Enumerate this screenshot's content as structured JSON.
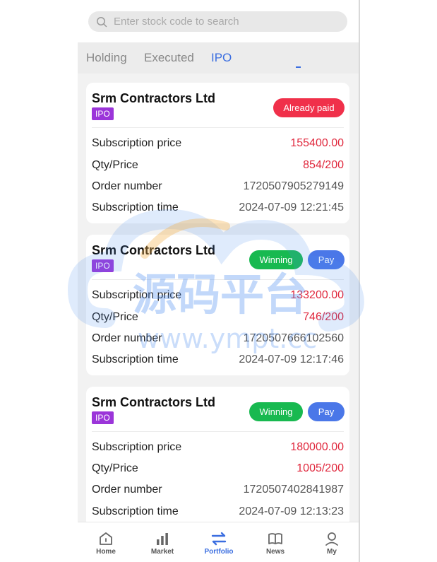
{
  "search": {
    "placeholder": "Enter stock code to search"
  },
  "tabs": [
    {
      "label": "Holding",
      "active": false
    },
    {
      "label": "Executed",
      "active": false
    },
    {
      "label": "IPO",
      "active": true
    }
  ],
  "accent_color": "#3b6ee0",
  "cards": [
    {
      "company": "Srm Contractors Ltd",
      "tag": "IPO",
      "buttons": [
        {
          "label": "Already paid",
          "color": "#f0304a"
        }
      ],
      "rows": [
        {
          "label": "Subscription price",
          "value": "155400.00"
        },
        {
          "label": "Qty/Price",
          "value": "854/200"
        },
        {
          "label": "Order number",
          "value": "1720507905279149"
        },
        {
          "label": "Subscription time",
          "value": "2024-07-09 12:21:45"
        }
      ]
    },
    {
      "company": "Srm Contractors Ltd",
      "tag": "IPO",
      "buttons": [
        {
          "label": "Winning",
          "color": "#18b950"
        },
        {
          "label": "Pay",
          "color": "#4a77e8"
        }
      ],
      "rows": [
        {
          "label": "Subscription price",
          "value": "133200.00"
        },
        {
          "label": "Qty/Price",
          "value": "746/200"
        },
        {
          "label": "Order number",
          "value": "1720507666102560"
        },
        {
          "label": "Subscription time",
          "value": "2024-07-09 12:17:46"
        }
      ]
    },
    {
      "company": "Srm Contractors Ltd",
      "tag": "IPO",
      "buttons": [
        {
          "label": "Winning",
          "color": "#18b950"
        },
        {
          "label": "Pay",
          "color": "#4a77e8"
        }
      ],
      "rows": [
        {
          "label": "Subscription price",
          "value": "180000.00"
        },
        {
          "label": "Qty/Price",
          "value": "1005/200"
        },
        {
          "label": "Order number",
          "value": "1720507402841987"
        },
        {
          "label": "Subscription time",
          "value": "2024-07-09 12:13:23"
        }
      ]
    }
  ],
  "watermark": {
    "text_cn": "源码平台",
    "text_url": "www.ympt.cc"
  },
  "nav": [
    {
      "label": "Home",
      "icon": "home-icon"
    },
    {
      "label": "Market",
      "icon": "market-icon"
    },
    {
      "label": "Portfolio",
      "icon": "portfolio-icon",
      "active": true
    },
    {
      "label": "News",
      "icon": "news-icon"
    },
    {
      "label": "My",
      "icon": "user-icon"
    }
  ]
}
